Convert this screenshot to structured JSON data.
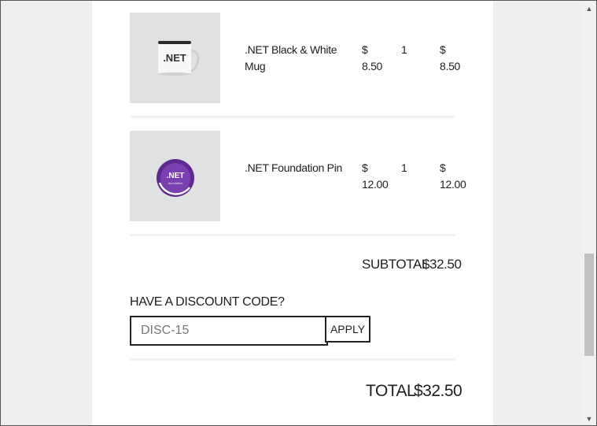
{
  "cart": {
    "items": [
      {
        "name_line1": ".NET Black & White",
        "name_line2": "Mug",
        "price_symbol": "$",
        "price": "8.50",
        "quantity": "1",
        "total_symbol": "$",
        "total": "8.50",
        "image_label": ".NET"
      },
      {
        "name_line1": ".NET Foundation Pin",
        "name_line2": "",
        "price_symbol": "$",
        "price": "12.00",
        "quantity": "1",
        "total_symbol": "$",
        "total": "12.00",
        "image_label": ".NET",
        "image_sublabel": "foundation"
      }
    ],
    "subtotal_label": "SUBTOTAL",
    "subtotal_value": "$32.50",
    "discount_label": "HAVE A DISCOUNT CODE?",
    "discount_value": "DISC-15",
    "apply_label": "APPLY",
    "total_label": "TOTAL",
    "total_value": "$32.50"
  },
  "scrollbar": {
    "up_arrow": "▲",
    "down_arrow": "▼",
    "position": 0.9
  }
}
